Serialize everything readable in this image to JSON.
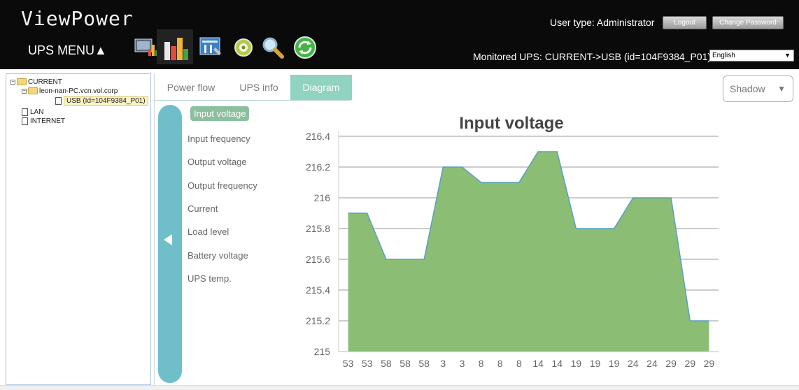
{
  "header": {
    "logo": "ViewPower",
    "ups_menu": "UPS MENU▲",
    "user_type": "User type: Administrator",
    "logout_label": "Logout",
    "change_password_label": "Change Password",
    "monitored": "Monitored UPS: CURRENT->USB (id=104F9384_P01)",
    "language": "English",
    "icons": [
      "monitor-chart-icon",
      "bar-chart-icon",
      "config-icon",
      "cd-icon",
      "search-icon",
      "refresh-icon"
    ]
  },
  "tree": {
    "root": "CURRENT",
    "host": "leon-nan-PC.vcn.vol.corp",
    "usb": "USB (Id=104F9384_P01)",
    "lan": "LAN",
    "internet": "INTERNET"
  },
  "tabs": [
    {
      "label": "Power flow",
      "active": false
    },
    {
      "label": "UPS info",
      "active": false
    },
    {
      "label": "Diagram",
      "active": true
    }
  ],
  "view_select": "Shadow",
  "metrics": [
    {
      "label": "Input voltage",
      "active": true
    },
    {
      "label": "Input frequency",
      "active": false
    },
    {
      "label": "Output voltage",
      "active": false
    },
    {
      "label": "Output frequency",
      "active": false
    },
    {
      "label": "Current",
      "active": false
    },
    {
      "label": "Load level",
      "active": false
    },
    {
      "label": "Battery voltage",
      "active": false
    },
    {
      "label": "UPS temp.",
      "active": false
    }
  ],
  "colors": {
    "area_fill": "#8cbd74",
    "area_line": "#5a9fbf",
    "grid": "#999999",
    "tab_active": "#8fd3c0",
    "toggle": "#6fbfca"
  },
  "chart_data": {
    "type": "area",
    "title": "Input voltage",
    "x": [
      "53",
      "53",
      "58",
      "58",
      "58",
      "3",
      "3",
      "8",
      "8",
      "8",
      "14",
      "14",
      "19",
      "19",
      "19",
      "24",
      "24",
      "29",
      "29",
      "29"
    ],
    "values": [
      215.9,
      215.9,
      215.6,
      215.6,
      215.6,
      216.2,
      216.2,
      216.1,
      216.1,
      216.1,
      216.3,
      216.3,
      215.8,
      215.8,
      215.8,
      216.0,
      216.0,
      216.0,
      215.2,
      215.2
    ],
    "yticks": [
      "215",
      "215.2",
      "215.4",
      "215.6",
      "215.8",
      "216",
      "216.2",
      "216.4"
    ],
    "ylim": [
      215,
      216.4
    ],
    "grid": true
  }
}
